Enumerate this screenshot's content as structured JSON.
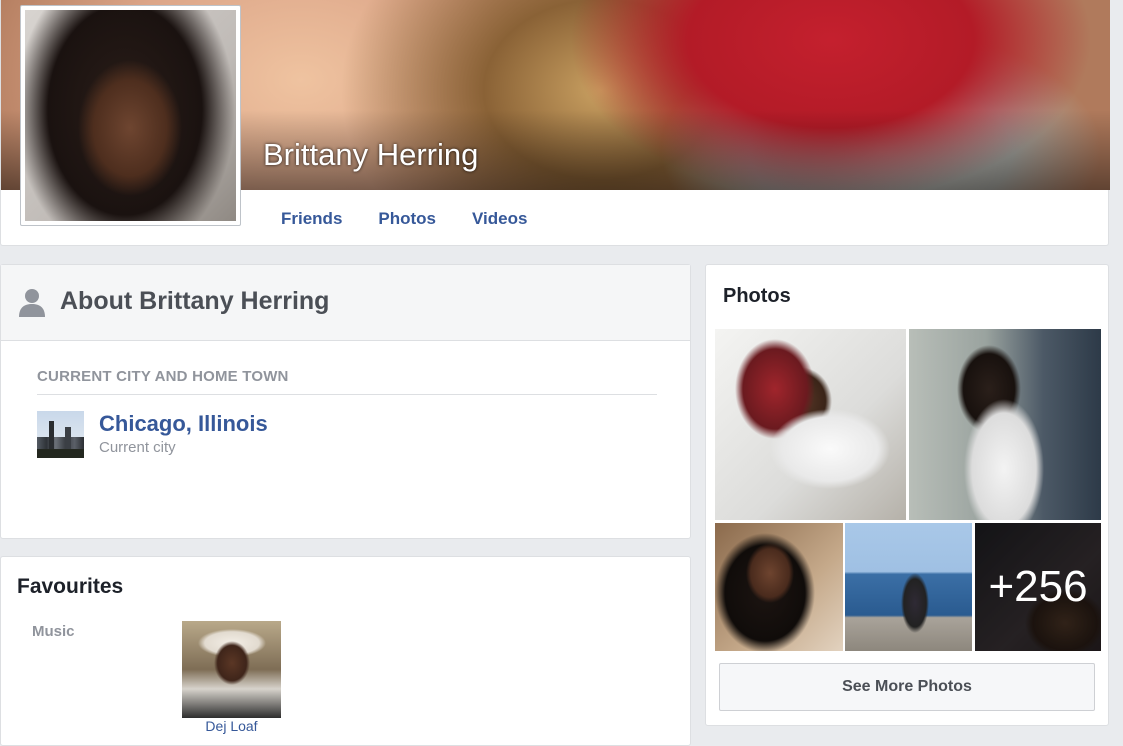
{
  "profile": {
    "name": "Brittany Herring",
    "tabs": [
      "Friends",
      "Photos",
      "Videos"
    ]
  },
  "about": {
    "title": "About Brittany Herring",
    "section_label": "CURRENT CITY AND HOME TOWN",
    "city": "Chicago, Illinois",
    "city_sub": "Current city"
  },
  "favourites": {
    "title": "Favourites",
    "category": "Music",
    "item_name": "Dej Loaf"
  },
  "photos": {
    "title": "Photos",
    "more_count": "+256",
    "see_more_label": "See More Photos"
  },
  "colors": {
    "link": "#365899",
    "page_bg": "#e9ebee",
    "muted": "#90949c"
  }
}
